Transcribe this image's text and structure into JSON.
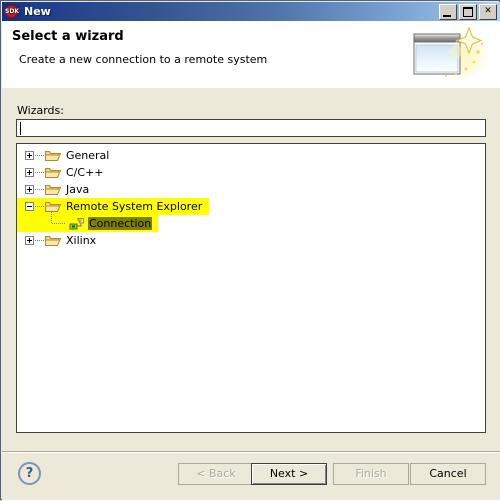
{
  "window": {
    "title": "New",
    "app_icon": "sdk-icon",
    "icon_text": "SDK",
    "controls": [
      {
        "name": "minimize-button",
        "glyph": "_"
      },
      {
        "name": "maximize-button",
        "glyph": "□"
      },
      {
        "name": "close-button",
        "glyph": "×"
      }
    ]
  },
  "header": {
    "title": "Select a wizard",
    "description": "Create a new connection to a remote system",
    "banner_icon": "wizard-window-sparkle-icon"
  },
  "body": {
    "wizards_label": "Wizards:",
    "filter": {
      "value": "",
      "placeholder": ""
    },
    "tree": [
      {
        "label": "General",
        "level": 0,
        "expanded": false,
        "twisty": "+",
        "icon": "folder-icon",
        "highlighted": false,
        "selected": false
      },
      {
        "label": "C/C++",
        "level": 0,
        "expanded": false,
        "twisty": "+",
        "icon": "folder-icon",
        "highlighted": false,
        "selected": false
      },
      {
        "label": "Java",
        "level": 0,
        "expanded": false,
        "twisty": "+",
        "icon": "folder-icon",
        "highlighted": false,
        "selected": false
      },
      {
        "label": "Remote System Explorer",
        "level": 0,
        "expanded": true,
        "twisty": "-",
        "icon": "folder-icon",
        "highlighted": true,
        "selected": false
      },
      {
        "label": "Connection",
        "level": 1,
        "expanded": null,
        "twisty": "",
        "icon": "connection-icon",
        "highlighted": true,
        "selected": true
      },
      {
        "label": "Xilinx",
        "level": 0,
        "expanded": false,
        "twisty": "+",
        "icon": "folder-icon",
        "highlighted": false,
        "selected": false
      }
    ]
  },
  "footer": {
    "help_label": "?",
    "buttons": [
      {
        "name": "back-button",
        "label": "< Back",
        "enabled": false,
        "default": false
      },
      {
        "name": "next-button",
        "label": "Next >",
        "enabled": true,
        "default": true
      },
      {
        "name": "finish-button",
        "label": "Finish",
        "enabled": false,
        "default": false
      },
      {
        "name": "cancel-button",
        "label": "Cancel",
        "enabled": true,
        "default": false
      }
    ]
  },
  "colors": {
    "title_gradient_start": "#15317c",
    "title_gradient_end": "#b9d4ef",
    "dialog_background": "#ece9d8",
    "highlight_yellow": "#ffff00",
    "selection_olive": "#808000",
    "accent_blue": "#3a5a8c"
  }
}
